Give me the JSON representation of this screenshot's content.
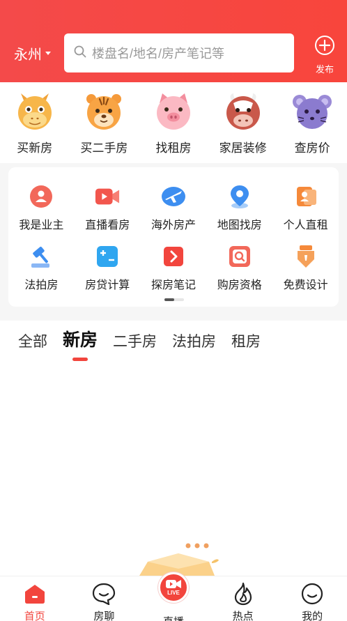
{
  "header": {
    "city": "永州",
    "search_placeholder": "楼盘名/地名/房产笔记等",
    "publish_label": "发布",
    "bg_color": "#f44a4a"
  },
  "categories": [
    {
      "label": "买新房",
      "icon": "dragon-icon"
    },
    {
      "label": "买二手房",
      "icon": "tiger-icon"
    },
    {
      "label": "找租房",
      "icon": "pig-icon"
    },
    {
      "label": "家居装修",
      "icon": "ox-icon"
    },
    {
      "label": "查房价",
      "icon": "rat-icon"
    }
  ],
  "tools": [
    {
      "label": "我是业主",
      "icon": "owner-icon",
      "color": "#f2685a"
    },
    {
      "label": "直播看房",
      "icon": "video-icon",
      "color": "#f2564d"
    },
    {
      "label": "海外房产",
      "icon": "plane-icon",
      "color": "#3d8ef0"
    },
    {
      "label": "地图找房",
      "icon": "location-pin-icon",
      "color": "#3d8ef0"
    },
    {
      "label": "个人直租",
      "icon": "contact-card-icon",
      "color": "#f5893a"
    },
    {
      "label": "法拍房",
      "icon": "gavel-icon",
      "color": "#3d8ef0"
    },
    {
      "label": "房贷计算",
      "icon": "calculator-icon",
      "color": "#2fa6f0"
    },
    {
      "label": "探房笔记",
      "icon": "arrow-note-icon",
      "color": "#f2453d"
    },
    {
      "label": "购房资格",
      "icon": "search-doc-icon",
      "color": "#f2685a"
    },
    {
      "label": "免费设计",
      "icon": "pen-nib-icon",
      "color": "#f5893a"
    }
  ],
  "tabs": [
    {
      "label": "全部",
      "active": false
    },
    {
      "label": "新房",
      "active": true
    },
    {
      "label": "二手房",
      "active": false
    },
    {
      "label": "法拍房",
      "active": false
    },
    {
      "label": "租房",
      "active": false
    }
  ],
  "bottom_nav": [
    {
      "label": "首页",
      "icon": "home-icon",
      "active": true
    },
    {
      "label": "房聊",
      "icon": "chat-icon",
      "active": false
    },
    {
      "label": "直播",
      "icon": "live-icon",
      "active": false,
      "badge": "LIVE"
    },
    {
      "label": "热点",
      "icon": "flame-icon",
      "active": false
    },
    {
      "label": "我的",
      "icon": "profile-icon",
      "active": false
    }
  ],
  "accent_color": "#f2453d"
}
